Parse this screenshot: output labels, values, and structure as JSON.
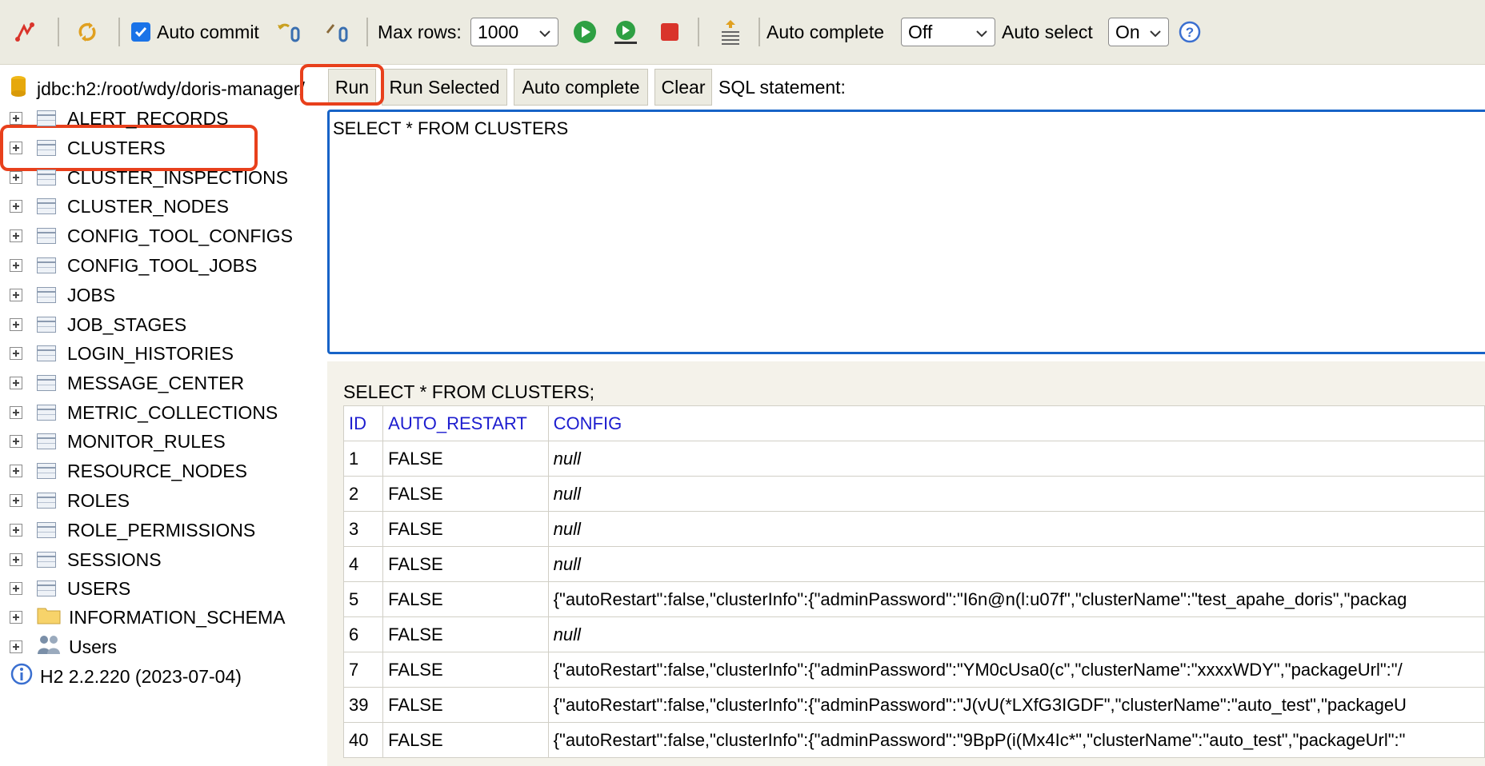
{
  "toolbar": {
    "auto_commit_label": "Auto commit",
    "max_rows_label": "Max rows:",
    "max_rows_value": "1000",
    "auto_complete_label": "Auto complete",
    "auto_complete_value": "Off",
    "auto_select_label": "Auto select",
    "auto_select_value": "On"
  },
  "connection": {
    "url": "jdbc:h2:/root/wdy/doris-manager/"
  },
  "buttons": {
    "run": "Run",
    "run_selected": "Run Selected",
    "auto_complete": "Auto complete",
    "clear": "Clear"
  },
  "sql_label": "SQL statement:",
  "sql_text": "SELECT * FROM CLUSTERS",
  "tree": {
    "tables": [
      "ALERT_RECORDS",
      "CLUSTERS",
      "CLUSTER_INSPECTIONS",
      "CLUSTER_NODES",
      "CONFIG_TOOL_CONFIGS",
      "CONFIG_TOOL_JOBS",
      "JOBS",
      "JOB_STAGES",
      "LOGIN_HISTORIES",
      "MESSAGE_CENTER",
      "METRIC_COLLECTIONS",
      "MONITOR_RULES",
      "RESOURCE_NODES",
      "ROLES",
      "ROLE_PERMISSIONS",
      "SESSIONS",
      "USERS"
    ],
    "schema": "INFORMATION_SCHEMA",
    "users": "Users",
    "version": "H2 2.2.220 (2023-07-04)"
  },
  "result": {
    "query": "SELECT * FROM CLUSTERS;",
    "columns": [
      "ID",
      "AUTO_RESTART",
      "CONFIG"
    ],
    "rows": [
      [
        "1",
        "FALSE",
        "null"
      ],
      [
        "2",
        "FALSE",
        "null"
      ],
      [
        "3",
        "FALSE",
        "null"
      ],
      [
        "4",
        "FALSE",
        "null"
      ],
      [
        "5",
        "FALSE",
        "{\"autoRestart\":false,\"clusterInfo\":{\"adminPassword\":\"I6n@n(l:u07f\",\"clusterName\":\"test_apahe_doris\",\"packag"
      ],
      [
        "6",
        "FALSE",
        "null"
      ],
      [
        "7",
        "FALSE",
        "{\"autoRestart\":false,\"clusterInfo\":{\"adminPassword\":\"YM0cUsa0(c\",\"clusterName\":\"xxxxWDY\",\"packageUrl\":\"/"
      ],
      [
        "39",
        "FALSE",
        "{\"autoRestart\":false,\"clusterInfo\":{\"adminPassword\":\"J(vU(*LXfG3IGDF\",\"clusterName\":\"auto_test\",\"packageU"
      ],
      [
        "40",
        "FALSE",
        "{\"autoRestart\":false,\"clusterInfo\":{\"adminPassword\":\"9BpP(i(Mx4Ic*\",\"clusterName\":\"auto_test\",\"packageUrl\":\""
      ]
    ]
  },
  "colors": {
    "accent": "#1763c7",
    "highlight": "#e8401c",
    "toolbar_bg": "#ecebe1",
    "header_text": "#1c1ccf"
  }
}
